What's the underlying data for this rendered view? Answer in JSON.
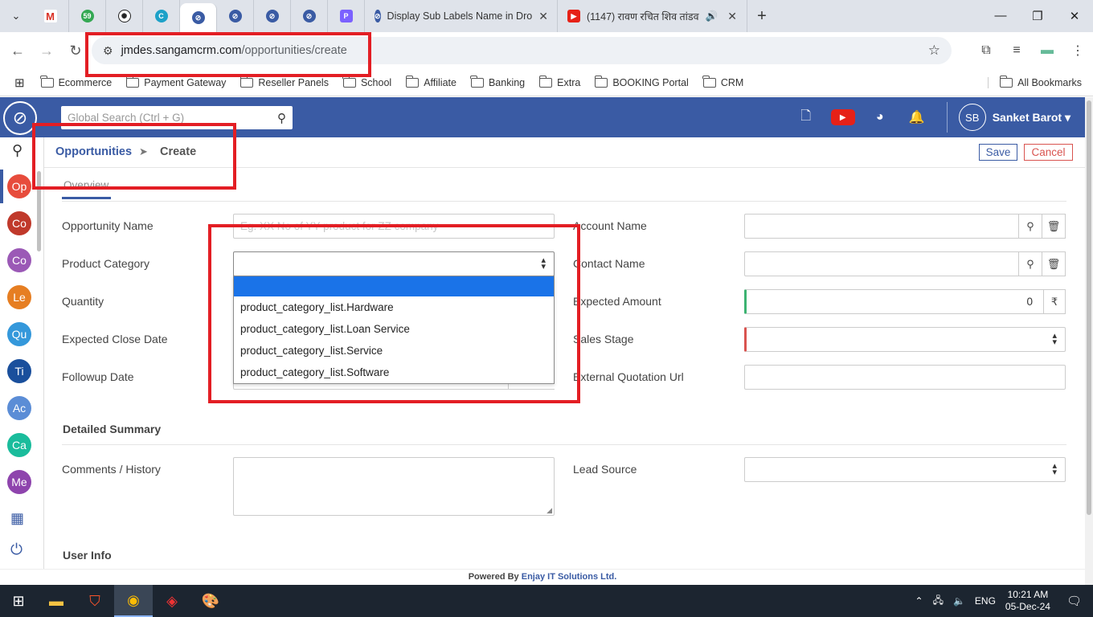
{
  "browser": {
    "tabs": [
      {
        "title": "Display Sub Labels Name in Dro"
      },
      {
        "title": "(1147) रावण रचित शिव तांडव"
      }
    ],
    "pinned_badge": "59",
    "url_domain": "jmdes.sangamcrm.com",
    "url_path": "/opportunities/create",
    "bookmarks": [
      "Ecommerce",
      "Payment Gateway",
      "Reseller Panels",
      "School",
      "Affiliate",
      "Banking",
      "Extra",
      "BOOKING Portal",
      "CRM"
    ],
    "all_bookmarks": "All Bookmarks"
  },
  "app": {
    "search_placeholder": "Global Search (Ctrl + G)",
    "user_initials": "SB",
    "user_name": "Sanket Barot",
    "sidebar": [
      "Op",
      "Co",
      "Co",
      "Le",
      "Qu",
      "Ti",
      "Ac",
      "Ca",
      "Me"
    ],
    "sidebar_colors": [
      "#e74c3c",
      "#c0392b",
      "#9b59b6",
      "#e67e22",
      "#3498db",
      "#1a4f9c",
      "#5b8dd6",
      "#1abc9c",
      "#8e44ad"
    ]
  },
  "breadcrumb": {
    "module": "Opportunities",
    "page": "Create"
  },
  "actions": {
    "save": "Save",
    "cancel": "Cancel"
  },
  "tabs": {
    "overview": "Overview"
  },
  "form": {
    "opportunity_name": {
      "label": "Opportunity Name",
      "placeholder": "Eg. XX No of YY product for ZZ company"
    },
    "product_category": {
      "label": "Product Category",
      "value": ""
    },
    "quantity": {
      "label": "Quantity"
    },
    "expected_close_date": {
      "label": "Expected Close Date"
    },
    "followup_date": {
      "label": "Followup Date"
    },
    "account_name": {
      "label": "Account Name"
    },
    "contact_name": {
      "label": "Contact Name"
    },
    "expected_amount": {
      "label": "Expected Amount",
      "value": "0",
      "currency": "₹"
    },
    "sales_stage": {
      "label": "Sales Stage"
    },
    "external_quotation_url": {
      "label": "External Quotation Url"
    },
    "detailed_summary": "Detailed Summary",
    "comments": {
      "label": "Comments / History"
    },
    "lead_source": {
      "label": "Lead Source"
    },
    "user_info": "User Info"
  },
  "dropdown_options": [
    "",
    "product_category_list.Hardware",
    "product_category_list.Loan Service",
    "product_category_list.Service",
    "product_category_list.Software"
  ],
  "footer": {
    "prefix": "Powered By",
    "company": "Enjay IT Solutions Ltd."
  },
  "taskbar": {
    "lang": "ENG",
    "time": "10:21 AM",
    "date": "05-Dec-24"
  }
}
